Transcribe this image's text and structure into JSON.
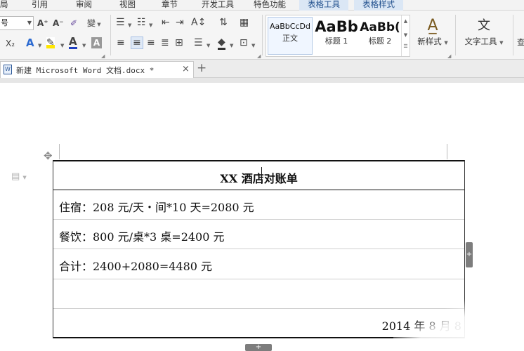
{
  "menu": {
    "tabs": [
      "局",
      "引用",
      "审阅",
      "视图",
      "章节",
      "开发工具",
      "特色功能",
      "表格工具",
      "表格样式"
    ]
  },
  "ribbon": {
    "font_size_label": "号",
    "grow_font": "A⁺",
    "shrink_font": "A⁻",
    "phonetic": "變",
    "subscript": "X₂",
    "styles": [
      {
        "sample": "AaBbCcDd",
        "name": "正文"
      },
      {
        "sample": "AaBb",
        "name": "标题 1"
      },
      {
        "sample": "AaBb(",
        "name": "标题 2"
      }
    ],
    "new_style_label": "新样式",
    "text_tools_label": "文字工具",
    "find_label": "查"
  },
  "document_tab": {
    "title": "新建 Microsoft Word 文档.docx *",
    "close": "×",
    "add": "+"
  },
  "table": {
    "title": "XX 酒店对账单",
    "rows": [
      "住宿：208 元/天・间*10 天=2080 元",
      "餐饮：800 元/桌*3 桌=2400 元",
      "合计：2400+2080=4480 元",
      ""
    ],
    "date": "2014 年 8 月 8"
  },
  "icons": {
    "move": "move-icon",
    "side_doc": "document-icon",
    "row_add": "plus-icon",
    "col_add": "plus-icon"
  },
  "colors": {
    "context_tab_bg": "#dbe7f5",
    "context_tab_text": "#1f4e8c",
    "ribbon_bg": "#f5f5f5"
  }
}
